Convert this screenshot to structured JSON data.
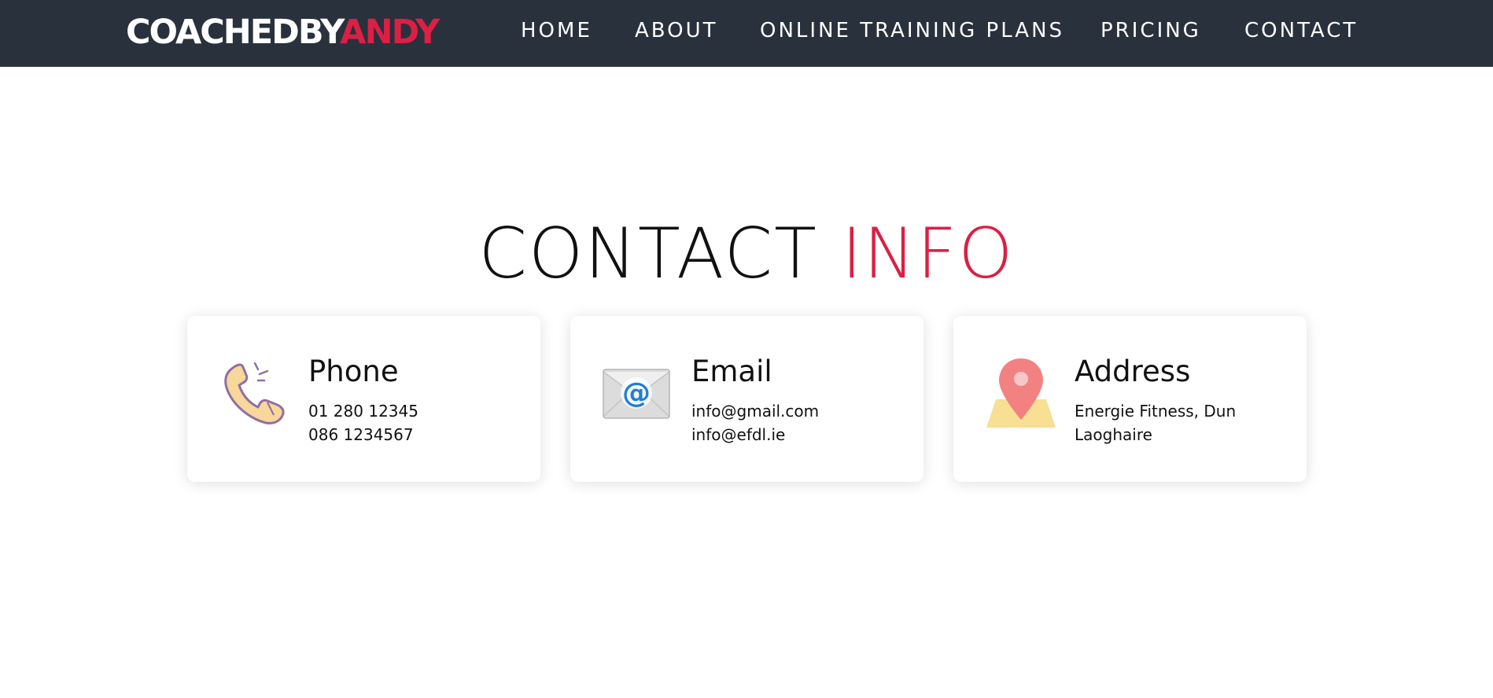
{
  "navbar": {
    "brand": {
      "part1": "COACHEDBY",
      "part2": "ANDY"
    },
    "links": [
      "HOME",
      "ABOUT",
      "ONLINE TRAINING PLANS",
      "PRICING",
      "CONTACT"
    ]
  },
  "heading": {
    "part1": "CONTACT",
    "part2": "INFO"
  },
  "cards": [
    {
      "title": "Phone",
      "lines": [
        "01 280 12345",
        "086 1234567"
      ],
      "icon": "phone-icon"
    },
    {
      "title": "Email",
      "lines": [
        "info@gmail.com",
        "info@efdl.ie"
      ],
      "icon": "envelope-at-icon"
    },
    {
      "title": "Address",
      "lines": [
        "Energie Fitness, Dun",
        "Laoghaire"
      ],
      "icon": "map-pin-icon"
    }
  ],
  "colors": {
    "navbar_bg": "#29313d",
    "accent": "#dc1f44",
    "text": "#111111",
    "white": "#ffffff"
  }
}
